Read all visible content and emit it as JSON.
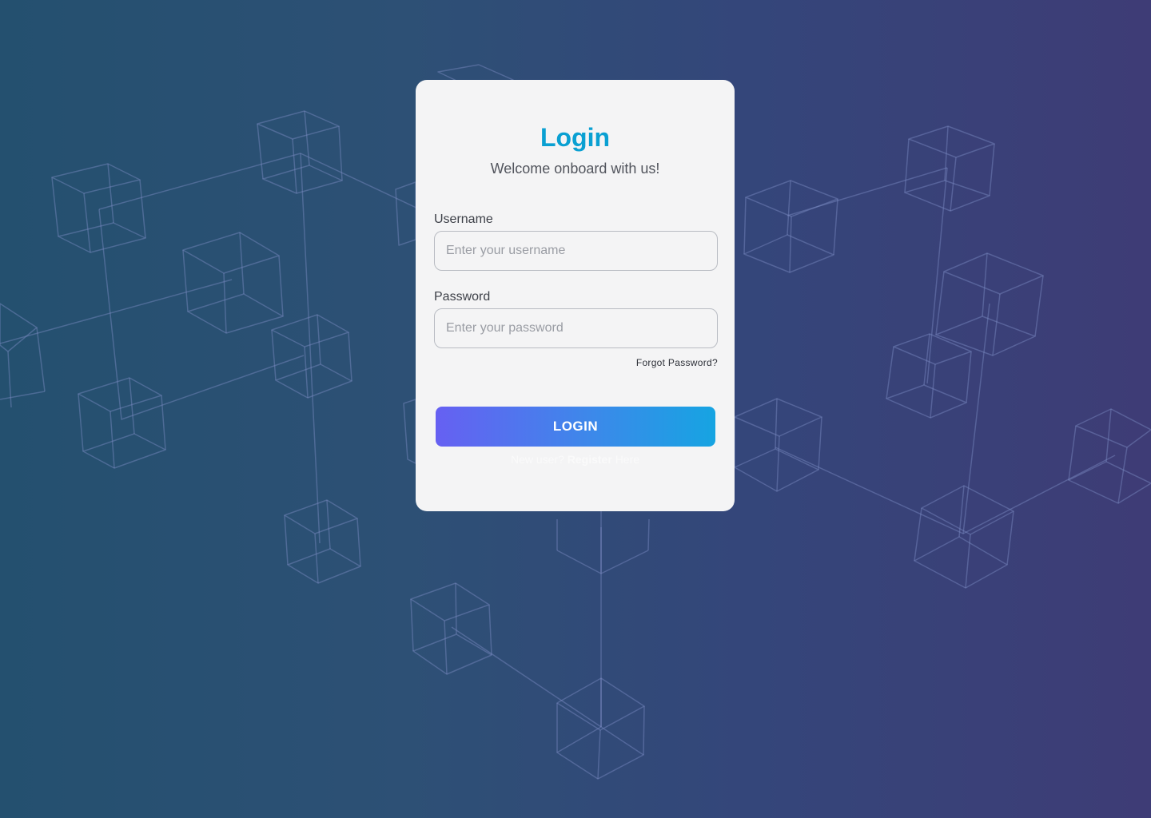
{
  "login_card": {
    "title": "Login",
    "subtitle": "Welcome onboard with us!",
    "username": {
      "label": "Username",
      "placeholder": "Enter your username",
      "value": ""
    },
    "password": {
      "label": "Password",
      "placeholder": "Enter your password",
      "value": ""
    },
    "forgot_password": "Forgot Password?",
    "login_button": "LOGIN",
    "register_prompt": {
      "before": "New user?",
      "link": "Register",
      "after": "Here"
    }
  },
  "colors": {
    "title": "#0aa0d2",
    "button_gradient_start": "#6660f2",
    "button_gradient_end": "#16a4e2",
    "card_background": "#f4f4f5"
  }
}
